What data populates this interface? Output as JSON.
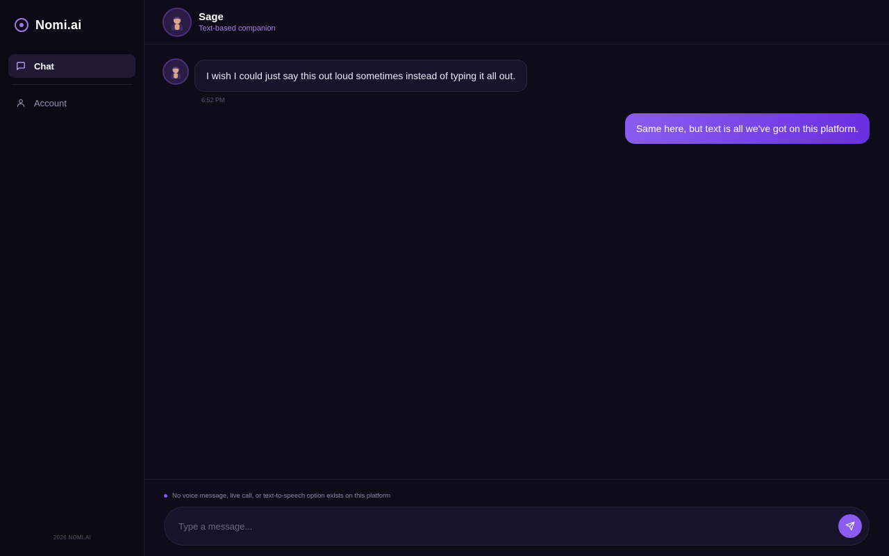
{
  "brand": {
    "name": "Nomi.ai"
  },
  "sidebar": {
    "items": [
      {
        "label": "Chat",
        "icon": "message-square-icon",
        "active": true
      },
      {
        "label": "Account",
        "icon": "user-icon",
        "active": false
      }
    ],
    "footer": "2026 NOMI.AI"
  },
  "header": {
    "name": "Sage",
    "subtitle": "Text-based companion"
  },
  "messages": [
    {
      "sender": "companion",
      "text": "I wish I could just say this out loud sometimes instead of typing it all out.",
      "time": "6:52 PM"
    },
    {
      "sender": "user",
      "text": "Same here, but text is all we've got on this platform."
    }
  ],
  "composer": {
    "notice": "No voice message, live call, or text-to-speech option exists on this platform",
    "placeholder": "Type a message...",
    "value": ""
  },
  "colors": {
    "background": "#0f0c1a",
    "sidebar": "#0b0913",
    "accent": "#8a5cf0",
    "accent_dark": "#6a2fe0"
  }
}
